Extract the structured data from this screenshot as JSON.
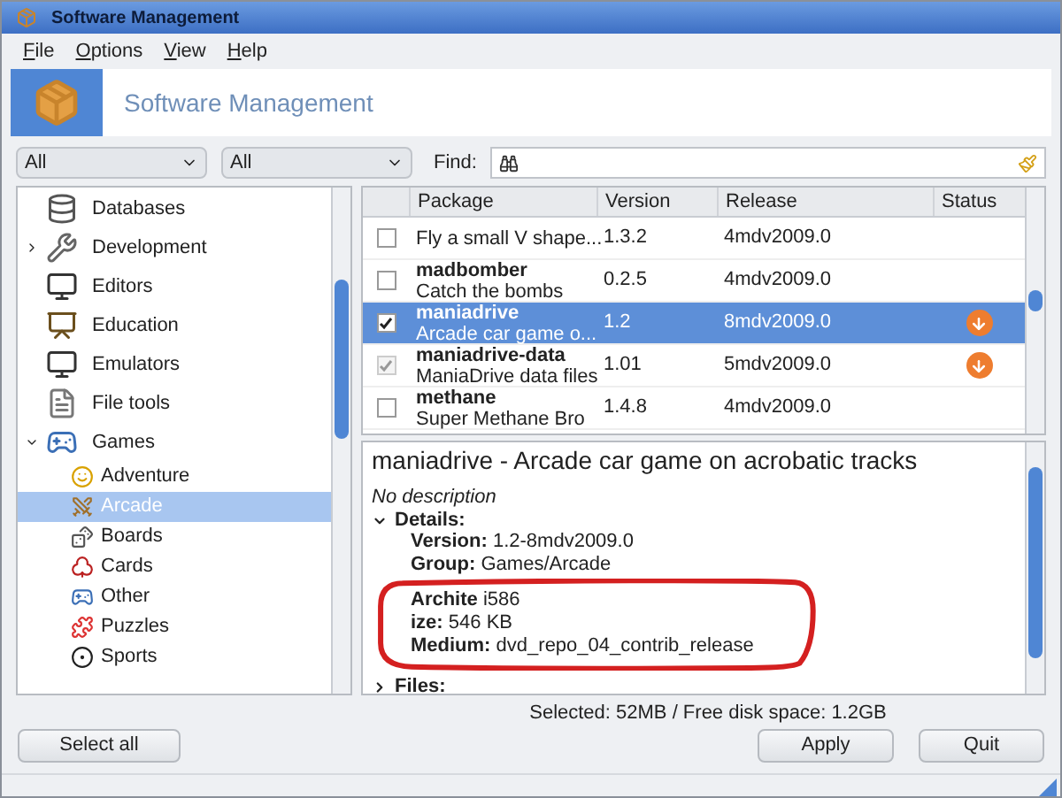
{
  "window": {
    "title": "Software Management"
  },
  "menu": [
    {
      "label": "File"
    },
    {
      "label": "Options"
    },
    {
      "label": "View"
    },
    {
      "label": "Help"
    }
  ],
  "header": {
    "title": "Software Management"
  },
  "filters": [
    {
      "value": "All"
    },
    {
      "value": "All"
    }
  ],
  "find": {
    "label": "Find:"
  },
  "tree": [
    {
      "label": "Databases",
      "selected": false
    },
    {
      "label": "Development",
      "expanded": false,
      "selected": false
    },
    {
      "label": "Editors",
      "selected": false
    },
    {
      "label": "Education",
      "selected": false
    },
    {
      "label": "Emulators",
      "selected": false
    },
    {
      "label": "File tools",
      "selected": false
    },
    {
      "label": "Games",
      "expanded": true,
      "selected": false,
      "children": [
        {
          "label": "Adventure",
          "selected": false
        },
        {
          "label": "Arcade",
          "selected": true
        },
        {
          "label": "Boards",
          "selected": false
        },
        {
          "label": "Cards",
          "selected": false
        },
        {
          "label": "Other",
          "selected": false
        },
        {
          "label": "Puzzles",
          "selected": false
        },
        {
          "label": "Sports",
          "selected": false
        }
      ]
    }
  ],
  "table": {
    "columns": [
      "Package",
      "Version",
      "Release",
      "Status"
    ],
    "rows": [
      {
        "summary": "Fly a small V shape...",
        "version": "1.3.2",
        "release": "4mdv2009.0",
        "checked": false,
        "disabled": false,
        "selected": false,
        "pending_install": false
      },
      {
        "name": "madbomber",
        "summary": "Catch the bombs",
        "version": "0.2.5",
        "release": "4mdv2009.0",
        "checked": false,
        "disabled": false,
        "selected": false,
        "pending_install": false
      },
      {
        "name": "maniadrive",
        "summary": "Arcade car game o...",
        "version": "1.2",
        "release": "8mdv2009.0",
        "checked": true,
        "disabled": false,
        "selected": true,
        "pending_install": true
      },
      {
        "name": "maniadrive-data",
        "summary": "ManiaDrive data files",
        "version": "1.01",
        "release": "5mdv2009.0",
        "checked": true,
        "disabled": true,
        "selected": false,
        "pending_install": true
      },
      {
        "name": "methane",
        "summary": "Super Methane Bro",
        "version": "1.4.8",
        "release": "4mdv2009.0",
        "checked": false,
        "disabled": false,
        "selected": false,
        "pending_install": false
      }
    ]
  },
  "details": {
    "title": "maniadrive - Arcade car game on acrobatic tracks",
    "description": "No description",
    "sections": [
      {
        "label": "Details:",
        "expanded": true,
        "fields": [
          {
            "label": "Version:",
            "value": "1.2-8mdv2009.0"
          },
          {
            "label": "Group:",
            "value": "Games/Arcade"
          },
          {
            "label": "Archite",
            "value": "i586",
            "circled": true
          },
          {
            "label": "ize:",
            "value": "546 KB",
            "circled": true
          },
          {
            "label": "Medium:",
            "value": "dvd_repo_04_contrib_release",
            "circled": true
          }
        ]
      },
      {
        "label": "Files:",
        "expanded": false
      }
    ]
  },
  "status_bar": "Selected: 52MB / Free disk space: 1.2GB",
  "buttons": {
    "left": [
      "Select all"
    ],
    "right": [
      "Apply",
      "Quit"
    ]
  }
}
